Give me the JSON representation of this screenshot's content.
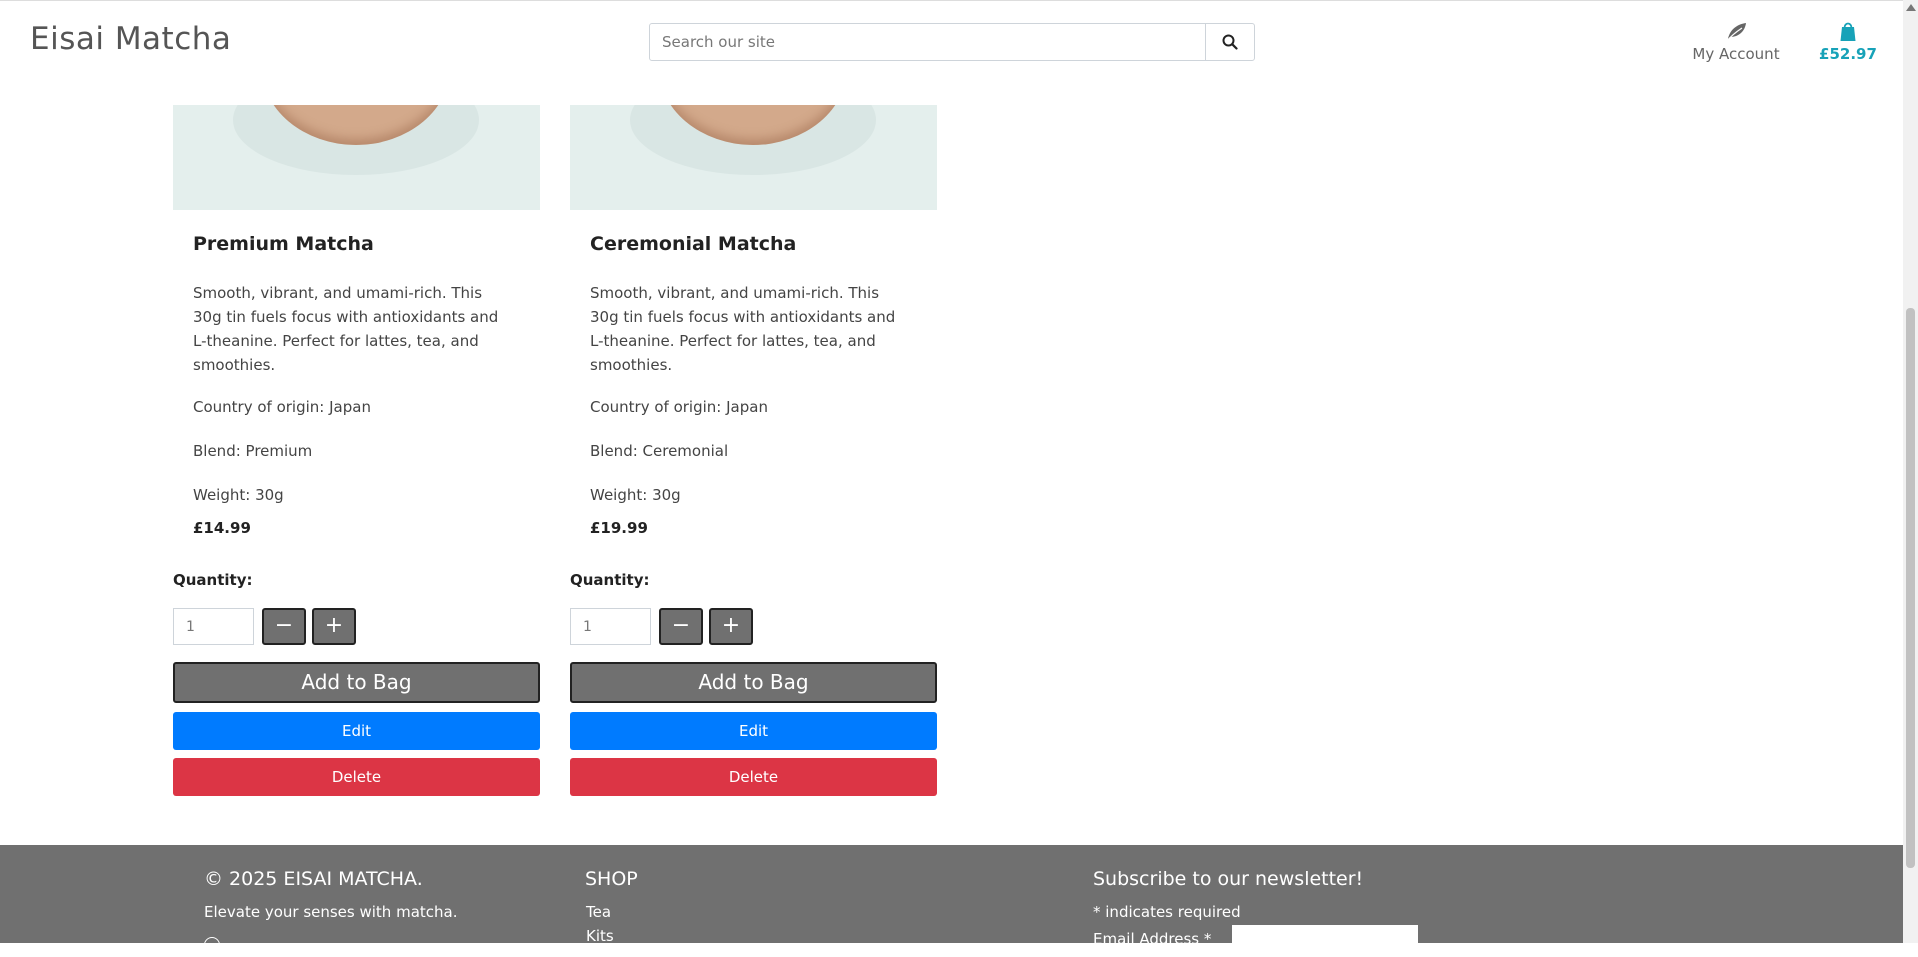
{
  "header": {
    "brand": "Eisai Matcha",
    "search_placeholder": "Search our site",
    "account_label": "My Account",
    "bag_total": "£52.97"
  },
  "products": [
    {
      "title": "Premium Matcha",
      "description": "Smooth, vibrant, and umami-rich. This 30g tin fuels focus with antioxidants and L-theanine. Perfect for lattes, tea, and smoothies.",
      "origin": "Country of origin: Japan",
      "blend": "Blend: Premium",
      "weight": "Weight: 30g",
      "price": "£14.99",
      "quantity_label": "Quantity:",
      "quantity_value": "1",
      "minus_label": "−",
      "plus_label": "+",
      "add_label": "Add to Bag",
      "edit_label": "Edit",
      "delete_label": "Delete"
    },
    {
      "title": "Ceremonial Matcha",
      "description": "Smooth, vibrant, and umami-rich. This 30g tin fuels focus with antioxidants and L-theanine. Perfect for lattes, tea, and smoothies.",
      "origin": "Country of origin: Japan",
      "blend": "Blend: Ceremonial",
      "weight": "Weight: 30g",
      "price": "£19.99",
      "quantity_label": "Quantity:",
      "quantity_value": "1",
      "minus_label": "−",
      "plus_label": "+",
      "add_label": "Add to Bag",
      "edit_label": "Edit",
      "delete_label": "Delete"
    }
  ],
  "footer": {
    "copyright": "© 2025 EISAI MATCHA.",
    "tagline": "Elevate your senses with matcha.",
    "shop_heading": "SHOP",
    "shop_links": [
      "Tea",
      "Kits"
    ],
    "newsletter_heading": "Subscribe to our newsletter!",
    "required_note": "* indicates required",
    "email_label": "Email Address *"
  },
  "colors": {
    "accent": "#17a2b8",
    "primary": "#007bff",
    "danger": "#dc3545",
    "neutral_button": "#707070",
    "footer_bg": "#707070"
  },
  "icons": {
    "search": "search-icon",
    "account": "leaf-icon",
    "bag": "shopping-bag-icon"
  }
}
